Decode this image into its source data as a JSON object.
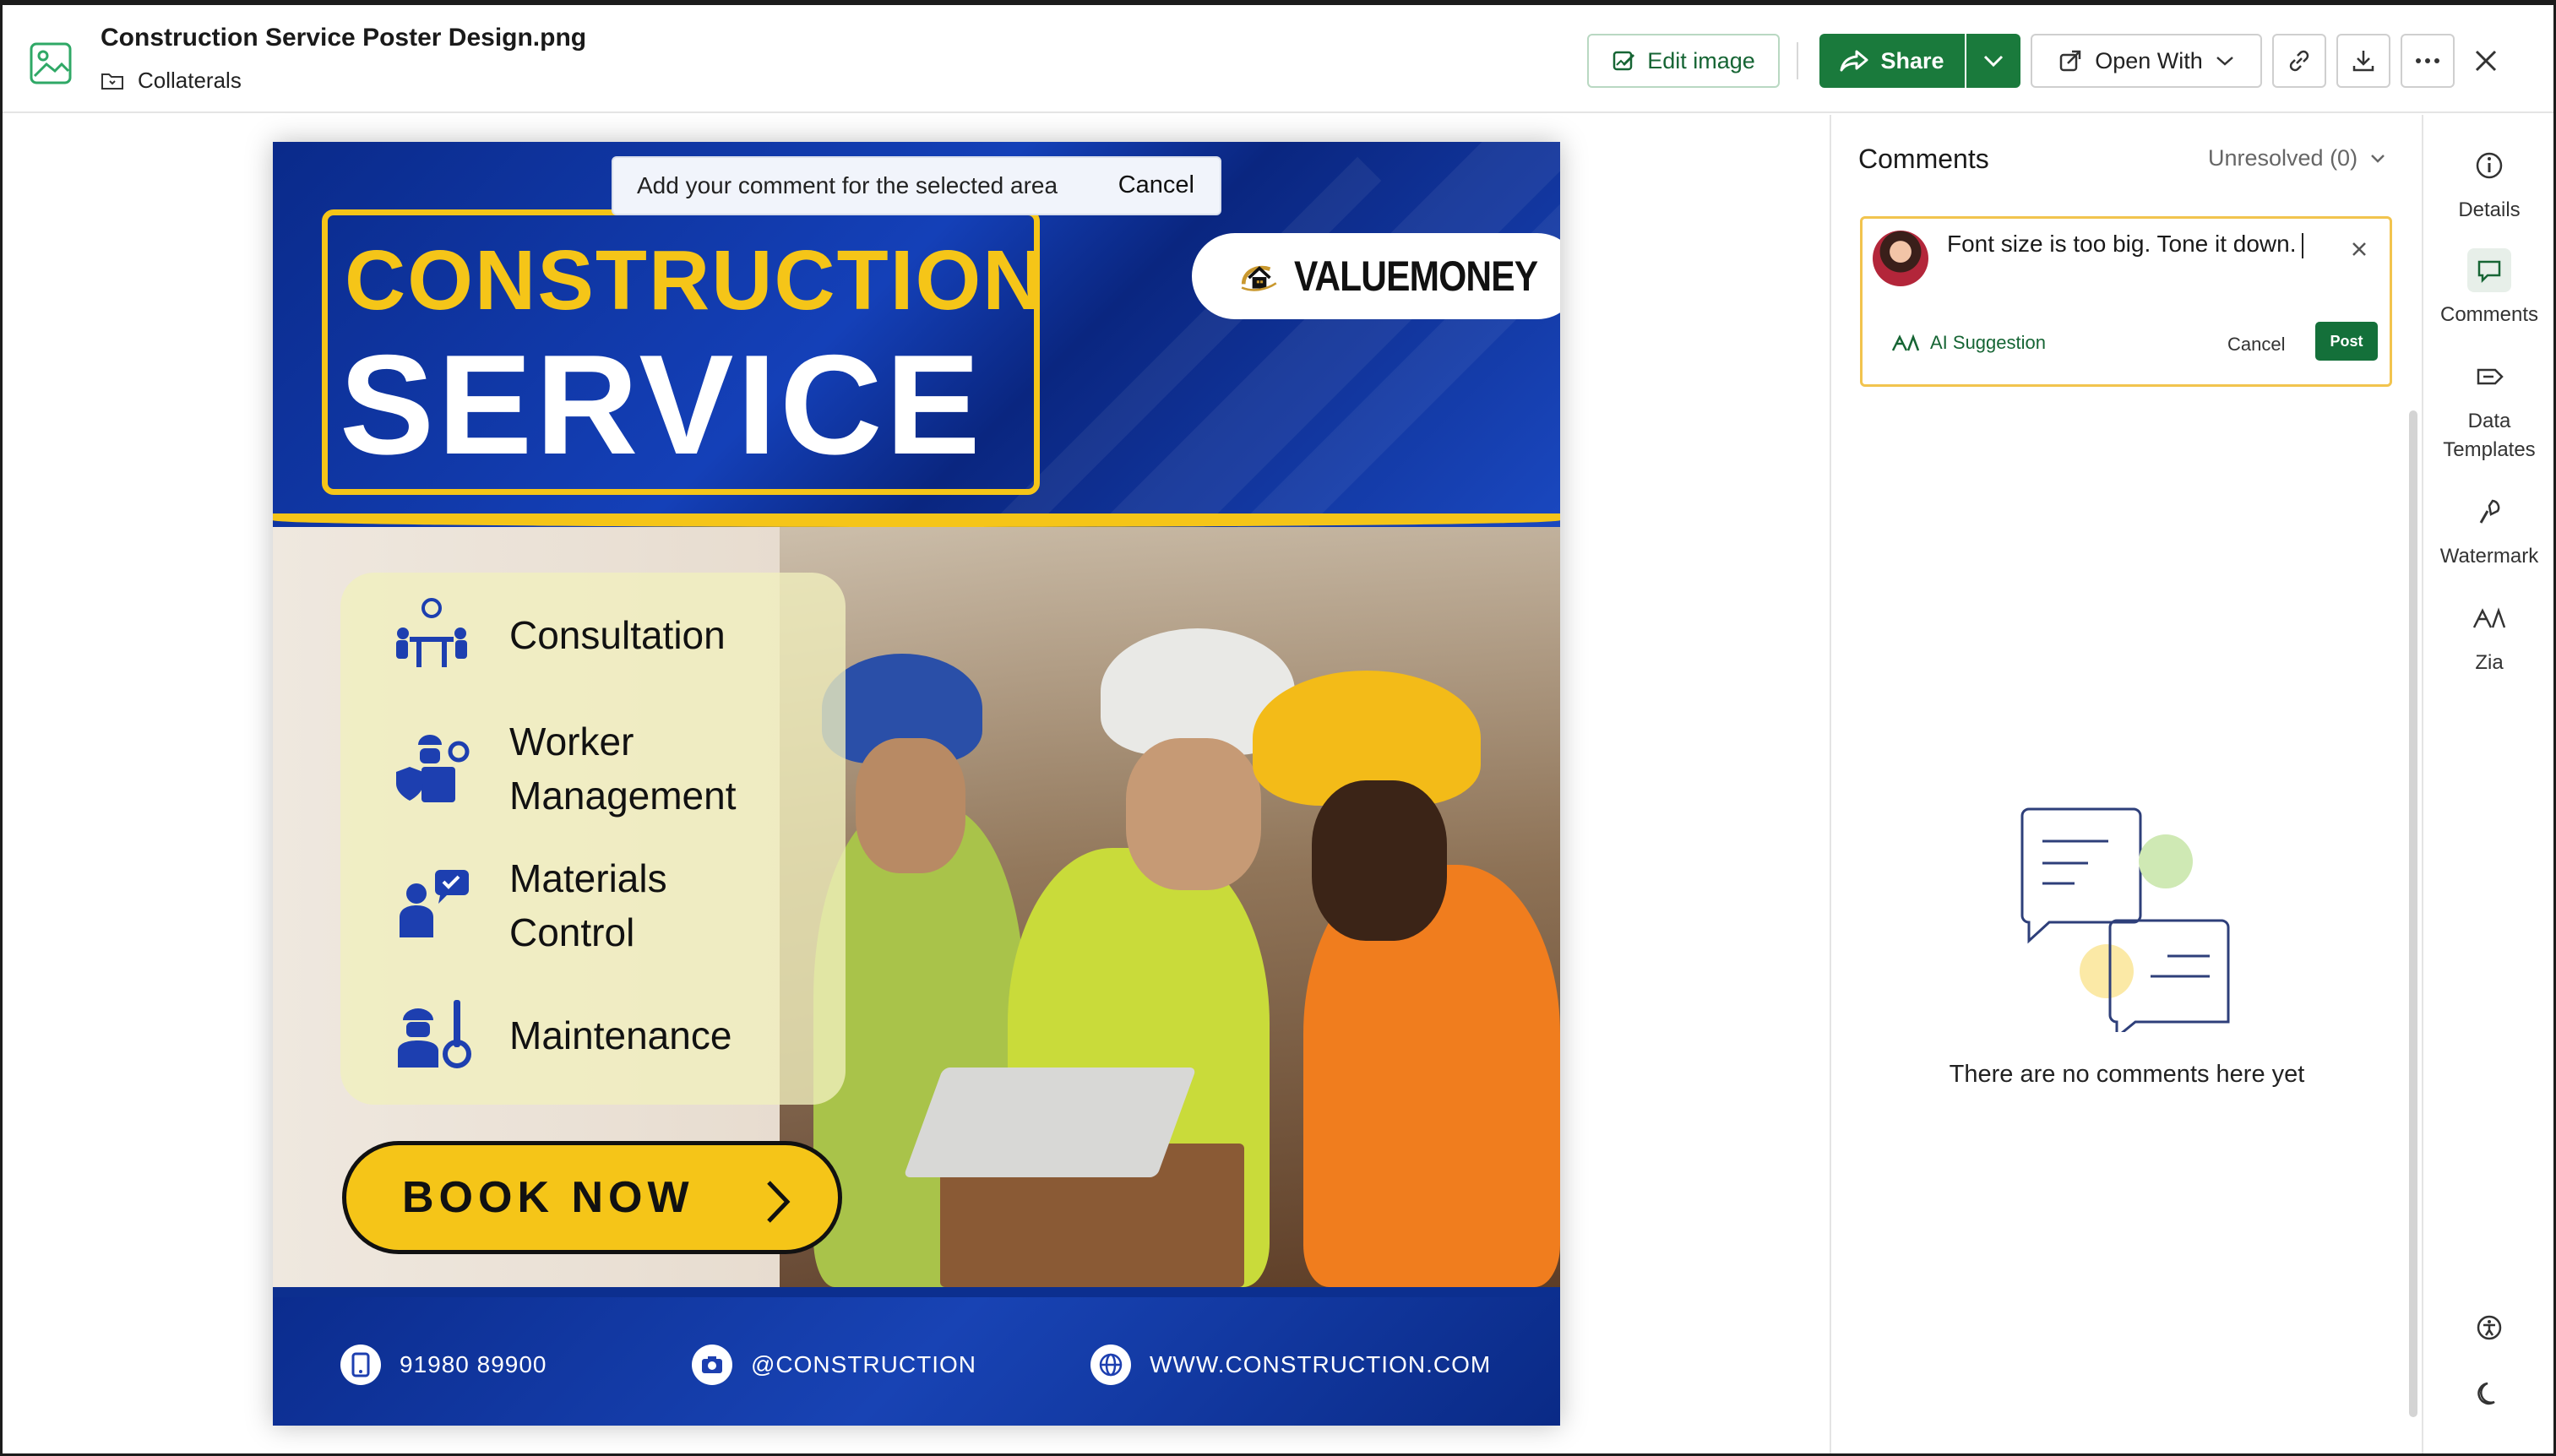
{
  "header": {
    "file_name": "Construction Service Poster Design.png",
    "folder": "Collaterals",
    "edit_image": "Edit image",
    "share": "Share",
    "open_with": "Open With"
  },
  "toast": {
    "message": "Add your comment for the selected area",
    "cancel": "Cancel"
  },
  "poster": {
    "title_line1": "CONSTRUCTION",
    "title_line2": "SERVICE",
    "brand": "VALUEMONEY",
    "services": [
      "Consultation",
      "Worker\nManagement",
      "Materials\nControl",
      "Maintenance"
    ],
    "cta": "BOOK NOW",
    "phone": "91980 89900",
    "instagram": "@CONSTRUCTION",
    "website": "WWW.CONSTRUCTION.COM"
  },
  "comments": {
    "title": "Comments",
    "filter": "Unresolved (0)",
    "draft_text": "Font size is too big. Tone it down.",
    "ai_suggestion": "AI Suggestion",
    "cancel": "Cancel",
    "post": "Post",
    "empty_message": "There are no comments here yet"
  },
  "rail": {
    "details": "Details",
    "comments": "Comments",
    "data_templates": "Data\nTemplates",
    "watermark": "Watermark",
    "zia": "Zia"
  },
  "colors": {
    "accent_green": "#1a7a3c",
    "poster_blue": "#0c2f8f",
    "poster_yellow": "#f5c518",
    "comment_border": "#f2c44e"
  }
}
